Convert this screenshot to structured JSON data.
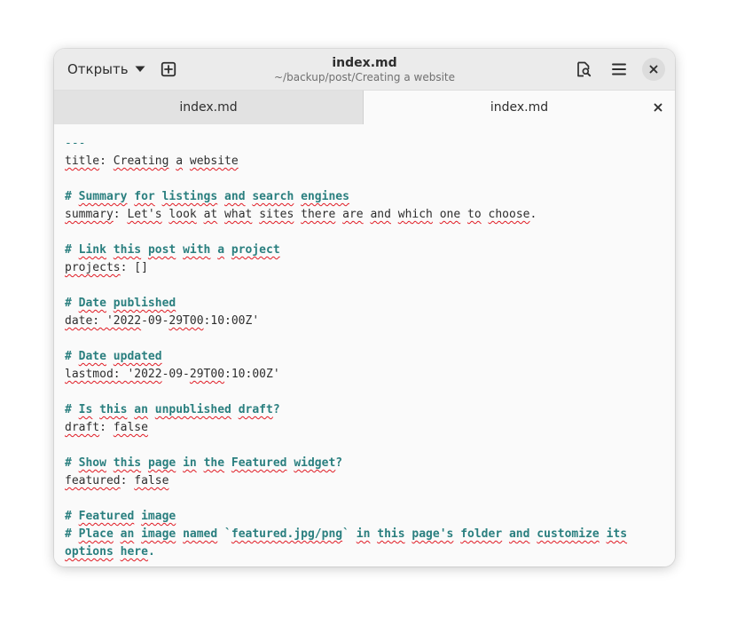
{
  "headerbar": {
    "open_label": "Открыть",
    "title": "index.md",
    "subtitle": "~/backup/post/Creating a website"
  },
  "icons": {
    "chevron": "chevron-down-icon",
    "new_tab": "new-tab-icon",
    "document_search": "document-search-icon",
    "menu": "hamburger-menu-icon",
    "close": "close-icon"
  },
  "colors": {
    "heading": "#2a7f7f",
    "text": "#2e2e2e",
    "spell_error": "#e01b24",
    "headerbar_bg": "#ebebeb",
    "editor_bg": "#fafafa"
  },
  "tabs": [
    {
      "label": "index.md",
      "active": false
    },
    {
      "label": "index.md",
      "active": true
    }
  ],
  "editor": {
    "lines": [
      {
        "text": "---",
        "segments": [
          {
            "t": "---",
            "c": "hm"
          }
        ]
      },
      {
        "text": "title: Creating a website",
        "segments": [
          {
            "t": "title",
            "c": "k sp"
          },
          {
            "t": ": ",
            "c": "p"
          },
          {
            "t": "Creating",
            "c": "k sp"
          },
          {
            "t": " ",
            "c": "p"
          },
          {
            "t": "a",
            "c": "k sp"
          },
          {
            "t": " ",
            "c": "p"
          },
          {
            "t": "website",
            "c": "k sp"
          }
        ]
      },
      {
        "text": "",
        "segments": []
      },
      {
        "text": "# Summary for listings and search engines",
        "segments": [
          {
            "t": "# ",
            "c": "hd"
          },
          {
            "t": "Summary",
            "c": "hd sp"
          },
          {
            "t": " ",
            "c": "hd"
          },
          {
            "t": "for",
            "c": "hd sp"
          },
          {
            "t": " ",
            "c": "hd"
          },
          {
            "t": "listings",
            "c": "hd sp"
          },
          {
            "t": " ",
            "c": "hd"
          },
          {
            "t": "and",
            "c": "hd sp"
          },
          {
            "t": " ",
            "c": "hd"
          },
          {
            "t": "search",
            "c": "hd sp"
          },
          {
            "t": " ",
            "c": "hd"
          },
          {
            "t": "engines",
            "c": "hd sp"
          }
        ]
      },
      {
        "text": "summary: Let's look at what sites there are and which one to choose.",
        "segments": [
          {
            "t": "summary",
            "c": "k sp"
          },
          {
            "t": ": ",
            "c": "p"
          },
          {
            "t": "Let's",
            "c": "k sp"
          },
          {
            "t": " ",
            "c": "p"
          },
          {
            "t": "look",
            "c": "k sp"
          },
          {
            "t": " ",
            "c": "p"
          },
          {
            "t": "at",
            "c": "k sp"
          },
          {
            "t": " ",
            "c": "p"
          },
          {
            "t": "what",
            "c": "k sp"
          },
          {
            "t": " ",
            "c": "p"
          },
          {
            "t": "sites",
            "c": "k sp"
          },
          {
            "t": " ",
            "c": "p"
          },
          {
            "t": "there",
            "c": "k sp"
          },
          {
            "t": " ",
            "c": "p"
          },
          {
            "t": "are",
            "c": "k sp"
          },
          {
            "t": " ",
            "c": "p"
          },
          {
            "t": "and",
            "c": "k sp"
          },
          {
            "t": " ",
            "c": "p"
          },
          {
            "t": "which",
            "c": "k sp"
          },
          {
            "t": " ",
            "c": "p"
          },
          {
            "t": "one",
            "c": "k sp"
          },
          {
            "t": " ",
            "c": "p"
          },
          {
            "t": "to",
            "c": "k sp"
          },
          {
            "t": " ",
            "c": "p"
          },
          {
            "t": "choose",
            "c": "k sp"
          },
          {
            "t": ".",
            "c": "p"
          }
        ]
      },
      {
        "text": "",
        "segments": []
      },
      {
        "text": "# Link this post with a project",
        "segments": [
          {
            "t": "# ",
            "c": "hd"
          },
          {
            "t": "Link",
            "c": "hd sp"
          },
          {
            "t": " ",
            "c": "hd"
          },
          {
            "t": "this",
            "c": "hd sp"
          },
          {
            "t": " ",
            "c": "hd"
          },
          {
            "t": "post",
            "c": "hd sp"
          },
          {
            "t": " ",
            "c": "hd"
          },
          {
            "t": "with",
            "c": "hd sp"
          },
          {
            "t": " ",
            "c": "hd"
          },
          {
            "t": "a",
            "c": "hd sp"
          },
          {
            "t": " ",
            "c": "hd"
          },
          {
            "t": "project",
            "c": "hd sp"
          }
        ]
      },
      {
        "text": "projects: []",
        "segments": [
          {
            "t": "projects",
            "c": "k sp"
          },
          {
            "t": ": []",
            "c": "p"
          }
        ]
      },
      {
        "text": "",
        "segments": []
      },
      {
        "text": "# Date published",
        "segments": [
          {
            "t": "# ",
            "c": "hd"
          },
          {
            "t": "Date",
            "c": "hd sp"
          },
          {
            "t": " ",
            "c": "hd"
          },
          {
            "t": "published",
            "c": "hd sp"
          }
        ]
      },
      {
        "text": "date: '2022-09-29T00:10:00Z'",
        "segments": [
          {
            "t": "date: '2022",
            "c": "k sp"
          },
          {
            "t": "-09-",
            "c": "p"
          },
          {
            "t": "29T00",
            "c": "k sp"
          },
          {
            "t": ":10:00Z'",
            "c": "p"
          }
        ]
      },
      {
        "text": "",
        "segments": []
      },
      {
        "text": "# Date updated",
        "segments": [
          {
            "t": "# ",
            "c": "hd"
          },
          {
            "t": "Date",
            "c": "hd sp"
          },
          {
            "t": " ",
            "c": "hd"
          },
          {
            "t": "updated",
            "c": "hd sp"
          }
        ]
      },
      {
        "text": "lastmod: '2022-09-29T00:10:00Z'",
        "segments": [
          {
            "t": "lastmod: '2022",
            "c": "k sp"
          },
          {
            "t": "-09-",
            "c": "p"
          },
          {
            "t": "29T00",
            "c": "k sp"
          },
          {
            "t": ":10:00Z'",
            "c": "p"
          }
        ]
      },
      {
        "text": "",
        "segments": []
      },
      {
        "text": "# Is this an unpublished draft?",
        "segments": [
          {
            "t": "# ",
            "c": "hd"
          },
          {
            "t": "Is",
            "c": "hd sp"
          },
          {
            "t": " ",
            "c": "hd"
          },
          {
            "t": "this",
            "c": "hd sp"
          },
          {
            "t": " ",
            "c": "hd"
          },
          {
            "t": "an",
            "c": "hd sp"
          },
          {
            "t": " ",
            "c": "hd"
          },
          {
            "t": "unpublished",
            "c": "hd sp"
          },
          {
            "t": " ",
            "c": "hd"
          },
          {
            "t": "draft",
            "c": "hd sp"
          },
          {
            "t": "?",
            "c": "hd"
          }
        ]
      },
      {
        "text": "draft: false",
        "segments": [
          {
            "t": "draft",
            "c": "k sp"
          },
          {
            "t": ": ",
            "c": "p"
          },
          {
            "t": "false",
            "c": "k sp"
          }
        ]
      },
      {
        "text": "",
        "segments": []
      },
      {
        "text": "# Show this page in the Featured widget?",
        "segments": [
          {
            "t": "# ",
            "c": "hd"
          },
          {
            "t": "Show",
            "c": "hd sp"
          },
          {
            "t": " ",
            "c": "hd"
          },
          {
            "t": "this",
            "c": "hd sp"
          },
          {
            "t": " ",
            "c": "hd"
          },
          {
            "t": "page",
            "c": "hd sp"
          },
          {
            "t": " ",
            "c": "hd"
          },
          {
            "t": "in",
            "c": "hd sp"
          },
          {
            "t": " ",
            "c": "hd"
          },
          {
            "t": "the",
            "c": "hd sp"
          },
          {
            "t": " ",
            "c": "hd"
          },
          {
            "t": "Featured",
            "c": "hd sp"
          },
          {
            "t": " ",
            "c": "hd"
          },
          {
            "t": "widget",
            "c": "hd sp"
          },
          {
            "t": "?",
            "c": "hd"
          }
        ]
      },
      {
        "text": "featured: false",
        "segments": [
          {
            "t": "featured",
            "c": "k sp"
          },
          {
            "t": ": ",
            "c": "p"
          },
          {
            "t": "false",
            "c": "k sp"
          }
        ]
      },
      {
        "text": "",
        "segments": []
      },
      {
        "text": "# Featured image",
        "segments": [
          {
            "t": "# ",
            "c": "hd"
          },
          {
            "t": "Featured",
            "c": "hd sp"
          },
          {
            "t": " ",
            "c": "hd"
          },
          {
            "t": "image",
            "c": "hd sp"
          }
        ]
      },
      {
        "text": "# Place an image named `featured.jpg/png` in this page's folder and customize its",
        "segments": [
          {
            "t": "# ",
            "c": "hd"
          },
          {
            "t": "Place",
            "c": "hd sp"
          },
          {
            "t": " ",
            "c": "hd"
          },
          {
            "t": "an",
            "c": "hd sp"
          },
          {
            "t": " ",
            "c": "hd"
          },
          {
            "t": "image",
            "c": "hd sp"
          },
          {
            "t": " ",
            "c": "hd"
          },
          {
            "t": "named",
            "c": "hd sp"
          },
          {
            "t": " `",
            "c": "hd"
          },
          {
            "t": "featured.jpg/png",
            "c": "hd sp"
          },
          {
            "t": "` ",
            "c": "hd"
          },
          {
            "t": "in",
            "c": "hd sp"
          },
          {
            "t": " ",
            "c": "hd"
          },
          {
            "t": "this",
            "c": "hd sp"
          },
          {
            "t": " ",
            "c": "hd"
          },
          {
            "t": "page's",
            "c": "hd sp"
          },
          {
            "t": " ",
            "c": "hd"
          },
          {
            "t": "folder",
            "c": "hd sp"
          },
          {
            "t": " ",
            "c": "hd"
          },
          {
            "t": "and",
            "c": "hd sp"
          },
          {
            "t": " ",
            "c": "hd"
          },
          {
            "t": "customize",
            "c": "hd sp"
          },
          {
            "t": " ",
            "c": "hd"
          },
          {
            "t": "its",
            "c": "hd sp"
          }
        ]
      },
      {
        "text": "options here.",
        "segments": [
          {
            "t": "options",
            "c": "hd sp"
          },
          {
            "t": " ",
            "c": "hd"
          },
          {
            "t": "here",
            "c": "hd sp"
          },
          {
            "t": ".",
            "c": "hd"
          }
        ]
      }
    ]
  }
}
